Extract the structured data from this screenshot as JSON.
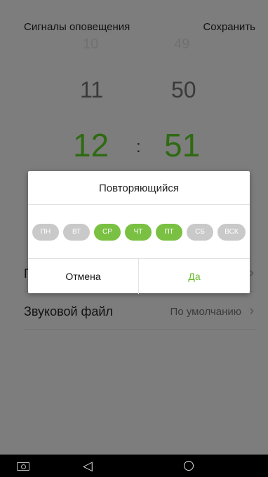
{
  "header": {
    "title": "Сигналы оповещения",
    "save_label": "Сохранить"
  },
  "time_picker": {
    "ghost_hour": "10",
    "ghost_minute": "49",
    "prev_hour": "11",
    "prev_minute": "50",
    "hour": "12",
    "colon": ":",
    "minute": "51"
  },
  "settings": {
    "repeat_label_partial": "П",
    "sound_label": "Звуковой файл",
    "sound_value": "По умолчанию"
  },
  "dialog": {
    "title": "Повторяющийся",
    "days": [
      {
        "label": "ПН",
        "selected": false
      },
      {
        "label": "ВТ",
        "selected": false
      },
      {
        "label": "СР",
        "selected": true
      },
      {
        "label": "ЧТ",
        "selected": true
      },
      {
        "label": "ПТ",
        "selected": true
      },
      {
        "label": "СБ",
        "selected": false
      },
      {
        "label": "ВСК",
        "selected": false
      }
    ],
    "cancel_label": "Отмена",
    "ok_label": "Да"
  },
  "colors": {
    "accent": "#7ac143",
    "day_off": "#c9c9c9",
    "time_current": "#2f6a12"
  },
  "nav": {
    "recent_icon": "recent-apps-icon",
    "back_icon": "back-icon",
    "home_icon": "home-icon"
  }
}
